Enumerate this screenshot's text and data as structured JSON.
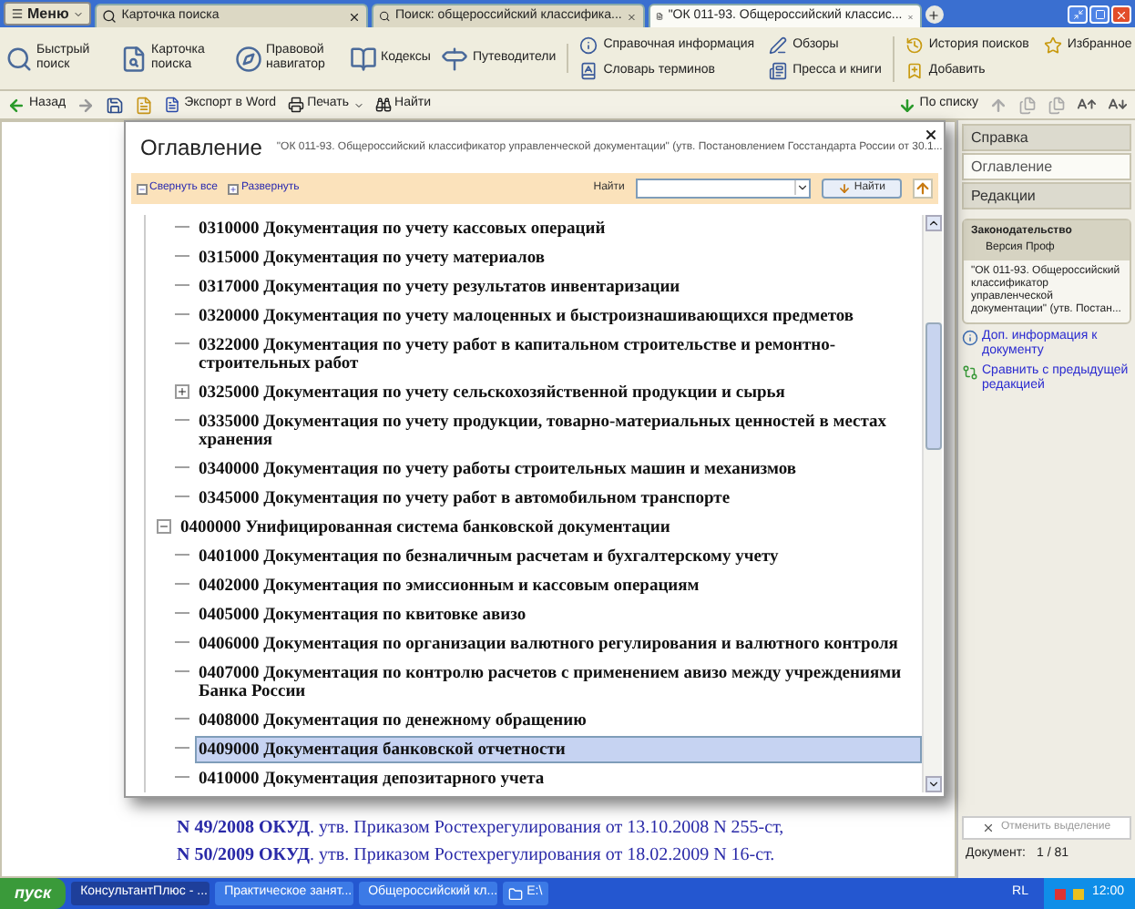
{
  "tabs": {
    "menu": "Меню",
    "items": [
      {
        "label": "Карточка поиска",
        "selected": false
      },
      {
        "label": "Поиск: общероссийский классифика...",
        "selected": false
      },
      {
        "label": "\"ОК 011-93. Общероссийский классис...",
        "selected": true
      }
    ]
  },
  "toolbar": {
    "main": [
      "Быстрый поиск",
      "Карточка поиска",
      "Правовой навигатор",
      "Кодексы",
      "Путеводители"
    ],
    "info": [
      "Справочная информация",
      "Обзоры",
      "Словарь терминов",
      "Пресса и книги"
    ],
    "user": [
      "История поисков",
      "Избранное",
      "Добавить"
    ]
  },
  "navbar": {
    "back": "Назад",
    "export": "Экспорт в Word",
    "print": "Печать",
    "find": "Найти",
    "by_list": "По списку"
  },
  "document": {
    "lines": [
      "**N 49/2008 ОКУД**. утв. Приказом Ростехрегулирования от 13.10.2008 N 255-ст,",
      "**N 50/2009 ОКУД**. утв. Приказом Ростехрегулирования от 18.02.2009 N 16-ст."
    ]
  },
  "dialog": {
    "title": "Оглавление",
    "document_title": "\"ОК 011-93. Общероссийский классификатор управленческой документации\" (утв. Постановлением Госстандарта России от 30.1...",
    "collapse_all": "Свернуть все",
    "expand": "Развернуть",
    "search_label": "Найти",
    "search_button": "Найти",
    "tree": {
      "continued": [
        {
          "label": "0310000 Документация по учету кассовых операций"
        },
        {
          "label": "0315000 Документация по учету материалов"
        },
        {
          "label": "0317000 Документация по учету результатов инвентаризации"
        },
        {
          "label": "0320000 Документация по учету малоценных и быстроизнашивающихся предметов"
        },
        {
          "label": "0322000 Документация по учету работ в капитальном строительстве и ремонтно-строительных работ"
        },
        {
          "label": "0325000 Документация по учету сельскохозяйственной продукции и сырья",
          "expanded": false
        },
        {
          "label": "0335000 Документация по учету продукции, товарно-материальных ценностей в местах хранения"
        },
        {
          "label": "0340000 Документация по учету работы строительных машин и механизмов"
        },
        {
          "label": "0345000 Документация по учету работ в автомобильном транспорте"
        }
      ],
      "nodes": [
        {
          "label": "0400000 Унифицированная система банковской документации",
          "expanded": true,
          "children": [
            {
              "label": "0401000 Документация по безналичным расчетам и бухгалтерскому учету",
              "selected": false
            },
            {
              "label": "0402000 Документация по эмиссионным и кассовым операциям",
              "selected": false
            },
            {
              "label": "0405000 Документация по квитовке авизо",
              "selected": false
            },
            {
              "label": "0406000 Документация по организации валютного регулирования и валютного контроля",
              "selected": false
            },
            {
              "label": "0407000 Документация по контролю расчетов с применением авизо между учреждениями Банка России",
              "selected": false
            },
            {
              "label": "0408000 Документация по денежному обращению",
              "selected": false
            },
            {
              "label": "0409000 Документация банковской отчетности",
              "selected": true
            },
            {
              "label": "0410000 Документация депозитарного учета",
              "selected": false
            }
          ]
        }
      ]
    }
  },
  "side_panel": {
    "tabs": [
      {
        "label": "Справка",
        "selected": false
      },
      {
        "label": "Оглавление",
        "selected": true
      },
      {
        "label": "Редакции",
        "selected": false
      }
    ],
    "card": {
      "heading": "Законодательство",
      "subheading": "Версия Проф",
      "text": "\"ОК 011-93. Общероссийский классификатор управленческой документации\" (утв. Постан..."
    },
    "links": [
      "Доп. информация к документу",
      "Сравнить с предыдущей редакцией"
    ],
    "clear_button": {
      "label": "Отменить выделение",
      "disabled": true
    },
    "doc_label": "Документ:",
    "doc_counter": "1 / 81"
  },
  "taskbar": {
    "start": "пуск",
    "tasks": [
      {
        "label": "КонсультантПлюс - ...",
        "selected": true
      },
      {
        "label": "Практическое занят...",
        "selected": false
      },
      {
        "label": "Общероссийский кл...",
        "selected": false
      },
      {
        "label": "E:\\",
        "selected": false
      }
    ],
    "lang": "RL",
    "clock": "12:00"
  }
}
